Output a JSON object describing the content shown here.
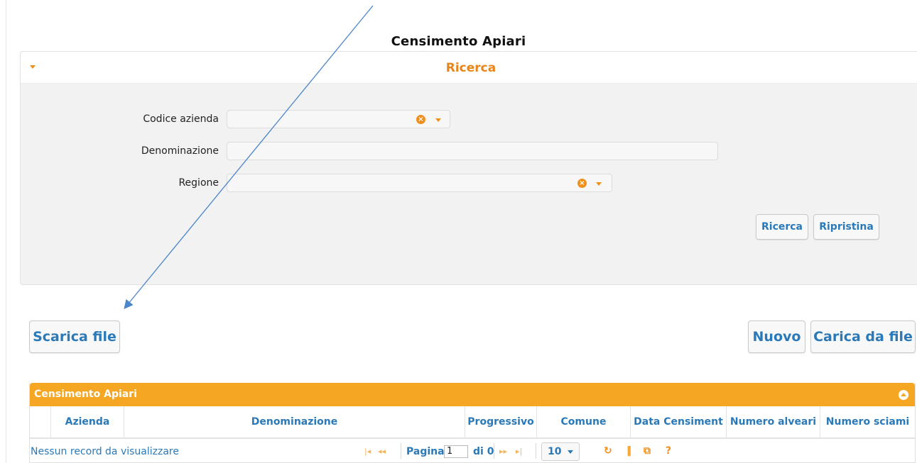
{
  "page": {
    "title": "Censimento Apiari"
  },
  "search": {
    "header": "Ricerca",
    "fields": {
      "codice_azienda": {
        "label": "Codice azienda",
        "value": ""
      },
      "denominazione": {
        "label": "Denominazione",
        "value": ""
      },
      "regione": {
        "label": "Regione",
        "value": ""
      }
    },
    "ricerca_button": "Ricerca",
    "ripristina_button": "Ripristina"
  },
  "actions": {
    "scarica_file": "Scarica file",
    "nuovo": "Nuovo",
    "carica_da_file": "Carica da file"
  },
  "grid": {
    "caption": "Censimento Apiari",
    "columns": [
      "",
      "Azienda",
      "Denominazione",
      "Progressivo",
      "Comune",
      "Data Censiment",
      "Numero alveari",
      "Numero sciami"
    ],
    "rows": [],
    "pager": {
      "empty_message": "Nessun record da visualizzare",
      "page_label": "Pagina",
      "page_value": "1",
      "of_label": "di 0",
      "page_size": "10",
      "help": "?"
    }
  },
  "colors": {
    "accent_orange": "#f5a623",
    "title_orange": "#e8851a",
    "link_blue": "#2a79b8",
    "annotation_arrow": "#4a86c8"
  }
}
